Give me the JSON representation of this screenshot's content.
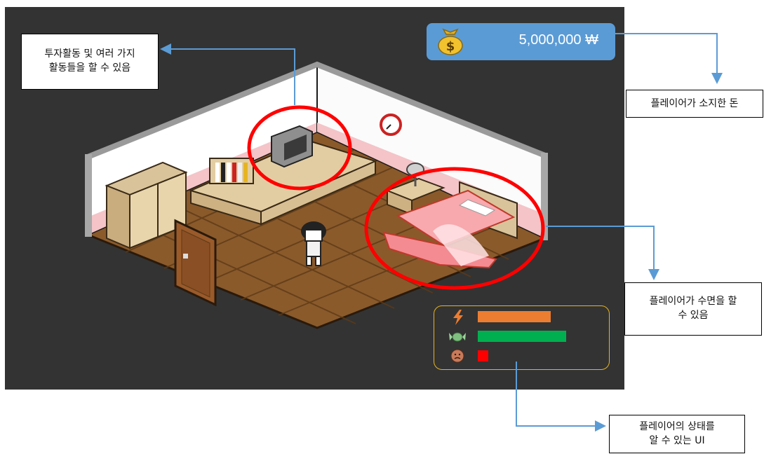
{
  "hud": {
    "money": "5,000,000 ₩",
    "money_icon": "money-bag-icon",
    "stats": [
      {
        "name": "energy",
        "icon": "lightning-icon",
        "color": "#ed7d31",
        "level": 0.7
      },
      {
        "name": "food",
        "icon": "candy-icon",
        "color": "#00b050",
        "level": 0.85
      },
      {
        "name": "mood",
        "icon": "sad-face-icon",
        "color": "#ff0000",
        "level": 0.1
      }
    ]
  },
  "annotations": {
    "activities": [
      "투자활동 및 여러 가지",
      "활동들을 할 수 있음"
    ],
    "money": [
      "플레이어가 소지한 돈"
    ],
    "sleep": [
      "플레이어가 수면을 할",
      "수 있음"
    ],
    "status": [
      "플레이어의 상태를",
      "알 수 있는 UI"
    ]
  },
  "colors": {
    "highlight_ring": "#ff0000",
    "connector": "#5b9bd5",
    "status_border": "#e6b422"
  }
}
